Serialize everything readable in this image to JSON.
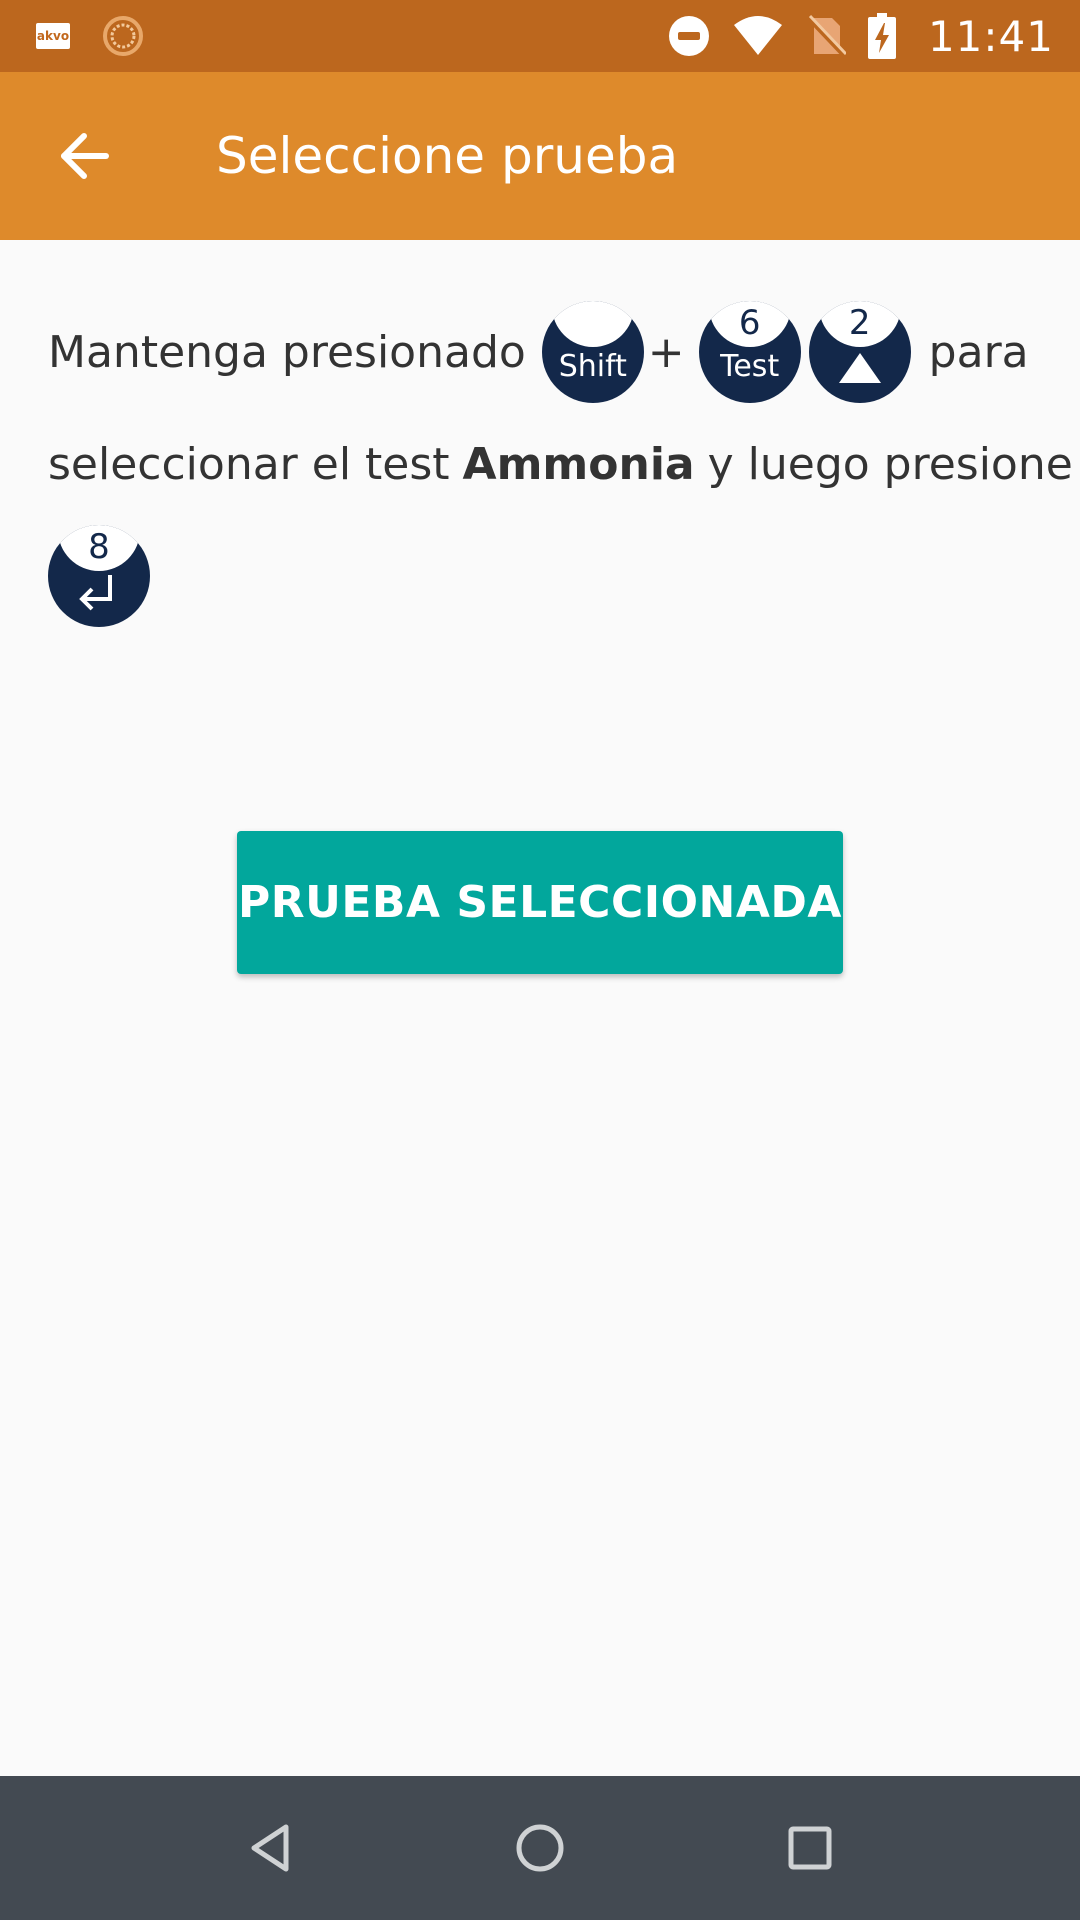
{
  "status_bar": {
    "app_icon_label": "akvo",
    "time": "11:41",
    "icons": [
      "akvo-icon",
      "sync-icon",
      "do-not-disturb-icon",
      "wifi-icon",
      "no-sim-icon",
      "battery-charging-icon"
    ]
  },
  "app_bar": {
    "title": "Seleccione prueba",
    "back_icon": "arrow-back-icon"
  },
  "instructions": {
    "text_1": "Mantenga presionado",
    "plus": "+",
    "text_2": "para",
    "text_3": "seleccionar el test",
    "test_name": "Ammonia",
    "text_4": "y luego presione",
    "keys": {
      "shift": {
        "number": "",
        "label": "Shift"
      },
      "test": {
        "number": "6",
        "label": "Test"
      },
      "up": {
        "number": "2",
        "label": ""
      },
      "enter": {
        "number": "8",
        "label": ""
      }
    }
  },
  "button": {
    "label": "PRUEBA SELECCIONADA"
  },
  "nav_bar": {
    "icons": [
      "back-triangle-icon",
      "home-circle-icon",
      "recents-square-icon"
    ]
  },
  "colors": {
    "status_bar": "#bc671e",
    "app_bar": "#de8a2b",
    "key": "#13284a",
    "button": "#02a79c",
    "nav_bar": "#434a52"
  }
}
